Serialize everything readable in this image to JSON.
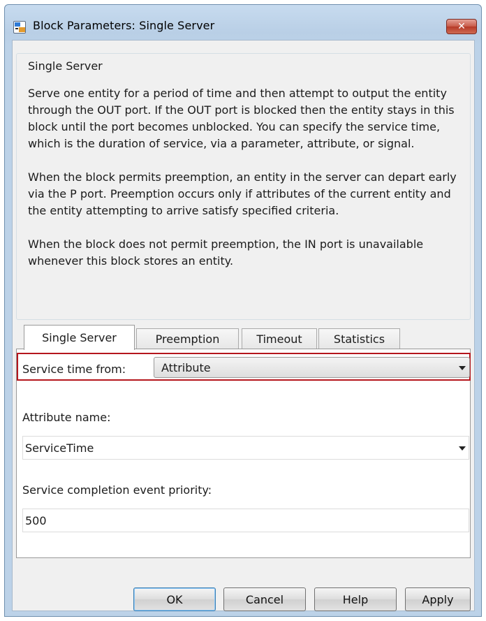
{
  "window": {
    "title": "Block Parameters: Single Server",
    "close_glyph": "✕"
  },
  "group": {
    "legend": "Single Server",
    "paragraphs": [
      "Serve one entity for a period of time and then attempt to output the entity through the OUT port. If the OUT port is blocked then the entity stays in this block until the port becomes unblocked. You can specify the service time, which is the duration of service, via a parameter, attribute, or signal.",
      "When the block permits preemption, an entity in the server can depart early via the P port. Preemption occurs only if attributes of the current entity and the entity attempting to arrive satisfy specified criteria.",
      "When the block does not permit preemption, the IN port is unavailable whenever this block stores an entity."
    ]
  },
  "tabs": [
    {
      "label": "Single Server",
      "active": true
    },
    {
      "label": "Preemption",
      "active": false
    },
    {
      "label": "Timeout",
      "active": false
    },
    {
      "label": "Statistics",
      "active": false
    }
  ],
  "form": {
    "service_time_label": "Service time from:",
    "service_time_value": "Attribute",
    "attribute_name_label": "Attribute name:",
    "attribute_name_value": "ServiceTime",
    "priority_label": "Service completion event priority:",
    "priority_value": "500"
  },
  "buttons": {
    "ok": "OK",
    "cancel": "Cancel",
    "help": "Help",
    "apply": "Apply"
  },
  "colors": {
    "highlight": "#b5161d",
    "titlebar": "#bcd2e8",
    "close_button": "#c75a48"
  },
  "icons": [
    "simulink-block-icon",
    "close-icon",
    "chevron-down-icon"
  ]
}
